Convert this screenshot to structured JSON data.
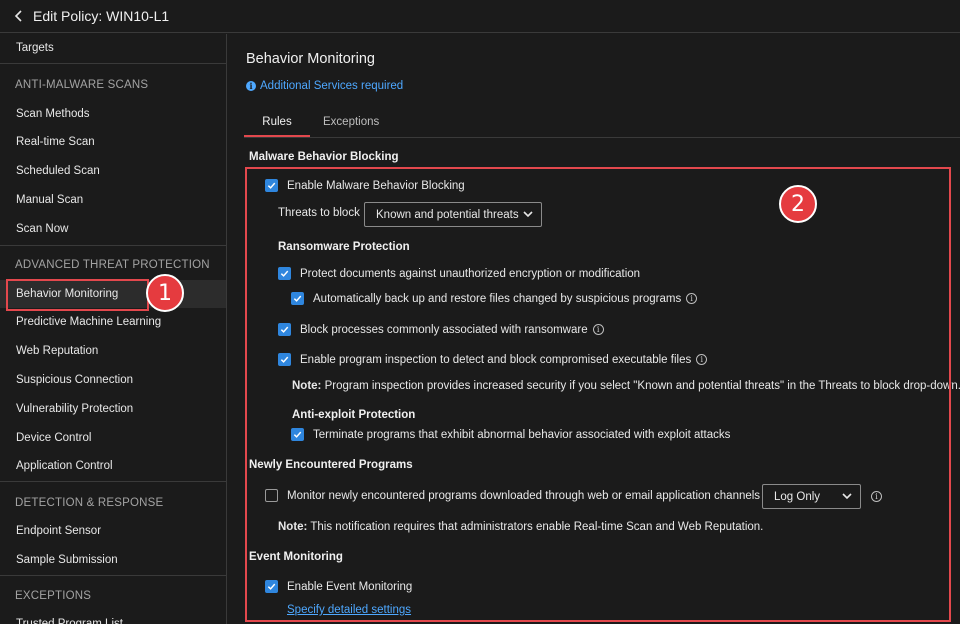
{
  "header": {
    "back_icon": "chevron-left-icon",
    "title": "Edit Policy: WIN10-L1"
  },
  "sidebar": {
    "targets": "Targets",
    "section_antimalware": "ANTI-MALWARE SCANS",
    "antimalware_items": [
      "Scan Methods",
      "Real-time Scan",
      "Scheduled Scan",
      "Manual Scan",
      "Scan Now"
    ],
    "section_atp": "ADVANCED THREAT PROTECTION",
    "atp_items": [
      "Behavior Monitoring",
      "Predictive Machine Learning",
      "Web Reputation",
      "Suspicious Connection",
      "Vulnerability Protection",
      "Device Control",
      "Application Control"
    ],
    "active_item": "Behavior Monitoring",
    "section_detection": "DETECTION & RESPONSE",
    "detection_items": [
      "Endpoint Sensor",
      "Sample Submission"
    ],
    "section_exceptions": "EXCEPTIONS",
    "exceptions_items": [
      "Trusted Program List"
    ]
  },
  "callouts": {
    "one": "1",
    "two": "2",
    "color": "#e3484d"
  },
  "main": {
    "title": "Behavior Monitoring",
    "notice": "Additional Services required",
    "tabs": [
      "Rules",
      "Exceptions"
    ],
    "active_tab": "Rules",
    "malware_section": {
      "title": "Malware Behavior Blocking",
      "enable_label": "Enable Malware Behavior Blocking",
      "enable_checked": true,
      "threats_label": "Threats to block",
      "threats_value": "Known and potential threats",
      "ransomware_title": "Ransomware Protection",
      "protect_docs_label": "Protect documents against unauthorized encryption or modification",
      "protect_docs_checked": true,
      "backup_label": "Automatically back up and restore files changed by suspicious programs",
      "backup_checked": true,
      "block_processes_label": "Block processes commonly associated with ransomware",
      "block_processes_checked": true,
      "inspection_label": "Enable program inspection to detect and block compromised executable files",
      "inspection_checked": true,
      "note_prefix": "Note:",
      "note_text": " Program inspection provides increased security if you select \"Known and potential threats\" in the Threats to block drop-down.",
      "antiexploit_title": "Anti-exploit Protection",
      "terminate_label": "Terminate programs that exhibit abnormal behavior associated with exploit attacks",
      "terminate_checked": true
    },
    "newly_section": {
      "title": "Newly Encountered Programs",
      "monitor_label": "Monitor newly encountered programs downloaded through web or email application channels",
      "monitor_checked": false,
      "mode_value": "Log Only",
      "note_prefix": "Note:",
      "note_text": " This notification requires that administrators enable Real-time Scan and Web Reputation."
    },
    "event_section": {
      "title": "Event Monitoring",
      "enable_label": "Enable Event Monitoring",
      "enable_checked": true,
      "settings_link": "Specify detailed settings"
    }
  },
  "colors": {
    "accent_red": "#e3484d",
    "checkbox_blue": "#2f86de",
    "link_blue": "#4ea8ff",
    "background": "#1b1b1b"
  }
}
